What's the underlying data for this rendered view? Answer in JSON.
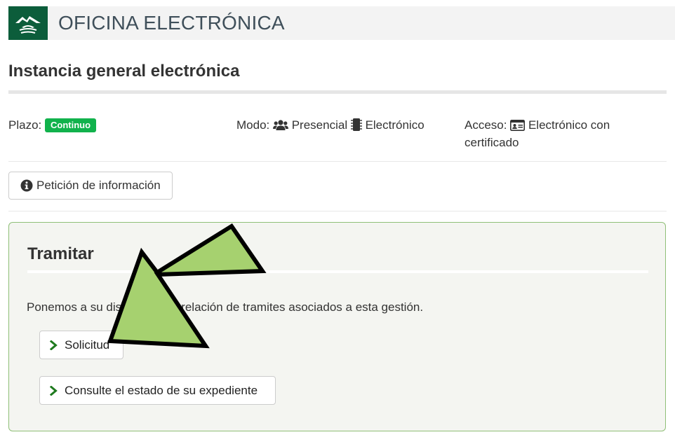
{
  "header": {
    "title": "OFICINA ELECTRÓNICA",
    "logo_icon": "mountain-landscape-icon",
    "brand_color": "#0c5d3b"
  },
  "page": {
    "title": "Instancia general electrónica"
  },
  "meta": {
    "plazo_label": "Plazo:",
    "plazo_badge": "Continuo",
    "modo_label": "Modo:",
    "modo_presencial": "Presencial",
    "modo_electronico": "Electrónico",
    "acceso_label": "Acceso:",
    "acceso_value": "Electrónico con certificado",
    "badge_color": "#11b24c"
  },
  "info_button": {
    "label": "Petición de información",
    "icon": "info-circle-icon"
  },
  "tramitar": {
    "title": "Tramitar",
    "description": "Ponemos a su disposición la relación de tramites asociados a esta gestión.",
    "actions": [
      {
        "label": "Solicitud",
        "icon": "chevron-right-icon"
      },
      {
        "label": "Consulte el estado de su expediente",
        "icon": "chevron-right-icon"
      }
    ],
    "accent_color": "#8fbf77",
    "chevron_color": "#1e7a1e"
  },
  "annotation": {
    "icon": "pointer-arrow-icon",
    "color": "#a6d16f"
  }
}
